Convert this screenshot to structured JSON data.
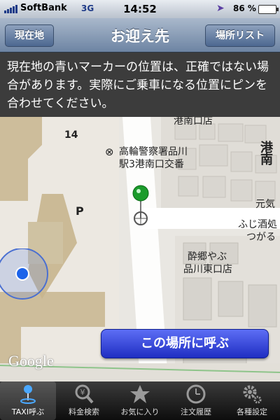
{
  "status": {
    "carrier": "SoftBank",
    "network": "3G",
    "time": "14:52",
    "battery": "86 %",
    "battery_level": 0.86
  },
  "nav": {
    "title": "お迎え先",
    "left_button": "現在地",
    "right_button": "場所リスト"
  },
  "notice": "現在地の青いマーカーの位置は、正確ではない場合があります。実際にご乗車になる位置にピンを合わせてください。",
  "map": {
    "labels": {
      "konan_top": "港南口店",
      "police_line1": "高輪警察署品川",
      "police_line2": "駅3港南口交番",
      "number_14": "14",
      "p": "P",
      "minato": "港南",
      "moto": "元気",
      "fuji1": "ふじ酒処",
      "fuji2": "つがる",
      "suigo1": "酔郷やぶ",
      "suigo2": "品川東口店"
    },
    "watermark": "Google"
  },
  "call_button": "この場所に呼ぶ",
  "tabs": [
    {
      "label": "TAXI呼ぶ",
      "icon": "taxi-pin-icon"
    },
    {
      "label": "料金検索",
      "icon": "yen-search-icon"
    },
    {
      "label": "お気に入り",
      "icon": "star-icon"
    },
    {
      "label": "注文履歴",
      "icon": "clock-icon"
    },
    {
      "label": "各種設定",
      "icon": "gear-icon"
    }
  ]
}
